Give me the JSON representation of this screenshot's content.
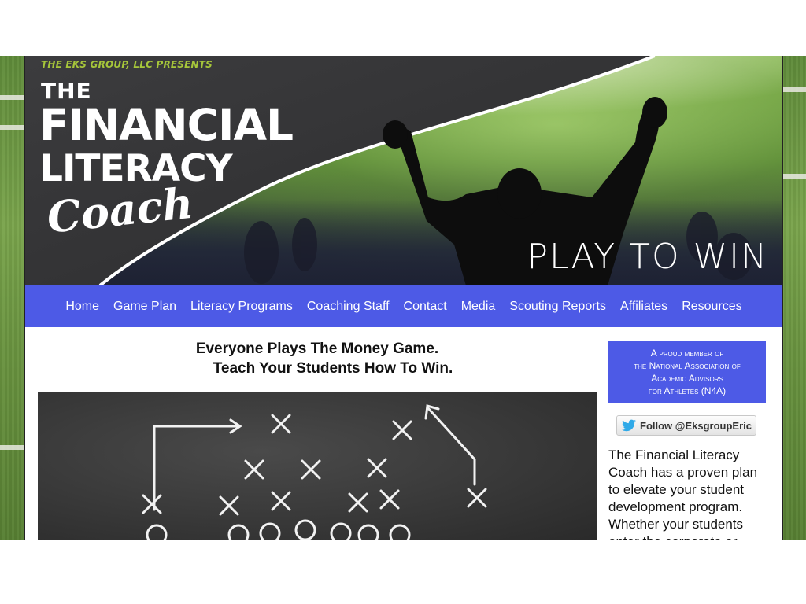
{
  "header": {
    "presents": "THE EKS GROUP, LLC PRESENTS",
    "title_the": "THE",
    "title_financial": "FINANCIAL",
    "title_literacy": "LITERACY",
    "title_coach": "Coach",
    "tagline": "PLAY TO WIN"
  },
  "nav": {
    "items": [
      "Home",
      "Game Plan",
      "Literacy Programs",
      "Coaching Staff",
      "Contact",
      "Media",
      "Scouting Reports",
      "Affiliates",
      "Resources"
    ]
  },
  "main": {
    "headline_line1": "Everyone Plays The Money Game.",
    "headline_line2": "Teach Your Students How To Win."
  },
  "sidebar": {
    "member_line1": "A proud member of",
    "member_line2": "the National Association of",
    "member_line3": "Academic Advisors",
    "member_line4": "for Athletes (N4A)",
    "follow_label": "Follow @EksgroupEric",
    "intro_text": "The Financial Literacy Coach has a proven plan to elevate your student development program. Whether your students enter the corporate or"
  },
  "colors": {
    "nav_bg": "#4d5ae6",
    "brand_green": "#a6c63a"
  },
  "icons": [
    "twitter-bird-icon"
  ]
}
